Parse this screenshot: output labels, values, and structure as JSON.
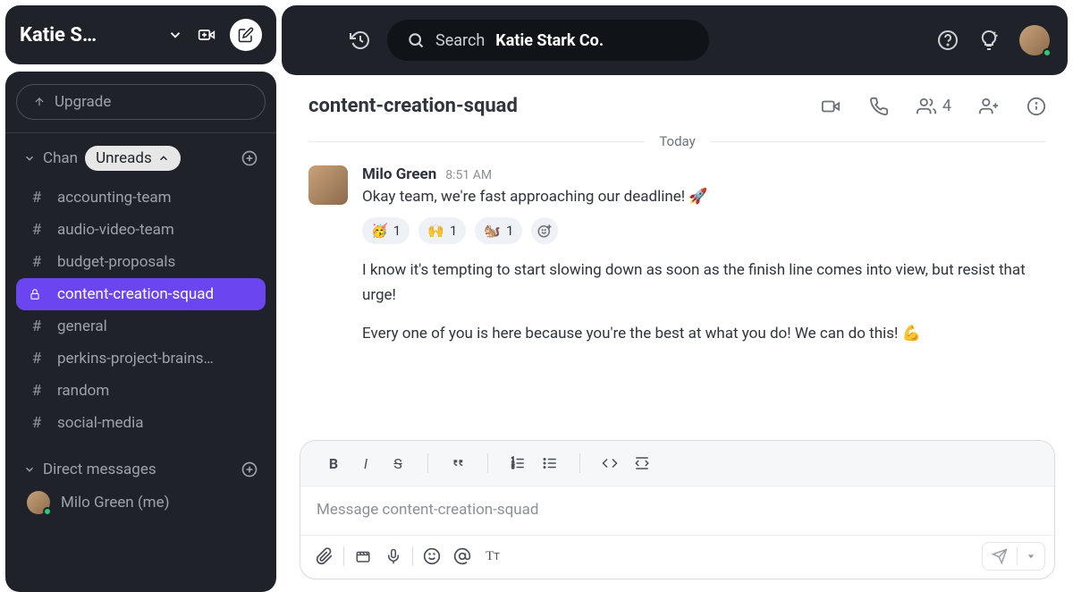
{
  "workspace": {
    "name": "Katie S…"
  },
  "sidebar": {
    "upgrade_label": "Upgrade",
    "channels_label": "Chan",
    "unreads_label": "Unreads",
    "items": [
      {
        "name": "accounting-team",
        "icon": "hash"
      },
      {
        "name": "audio-video-team",
        "icon": "hash"
      },
      {
        "name": "budget-proposals",
        "icon": "hash"
      },
      {
        "name": "content-creation-squad",
        "icon": "lock",
        "active": true
      },
      {
        "name": "general",
        "icon": "hash"
      },
      {
        "name": "perkins-project-brains…",
        "icon": "hash"
      },
      {
        "name": "random",
        "icon": "hash"
      },
      {
        "name": "social-media",
        "icon": "hash"
      }
    ],
    "dm_label": "Direct messages",
    "dm_items": [
      {
        "name": "Milo Green (me)"
      }
    ]
  },
  "search": {
    "placeholder": "Search",
    "company": "Katie Stark Co."
  },
  "channel_header": {
    "title": "content-creation-squad",
    "member_count": "4"
  },
  "divider": {
    "label": "Today"
  },
  "messages": [
    {
      "author": "Milo Green",
      "time": "8:51 AM",
      "line1": "Okay team, we're fast approaching our deadline! 🚀",
      "reactions": [
        {
          "emoji": "🥳",
          "count": "1"
        },
        {
          "emoji": "🙌",
          "count": "1"
        },
        {
          "emoji": "🐿️",
          "count": "1"
        }
      ],
      "para1": "I know it's tempting to start slowing down as soon as the finish line comes into view, but resist that urge!",
      "para2": "Every one of you is here because you're the best at what you do! We can do this! 💪"
    }
  ],
  "composer": {
    "placeholder": "Message content-creation-squad"
  }
}
